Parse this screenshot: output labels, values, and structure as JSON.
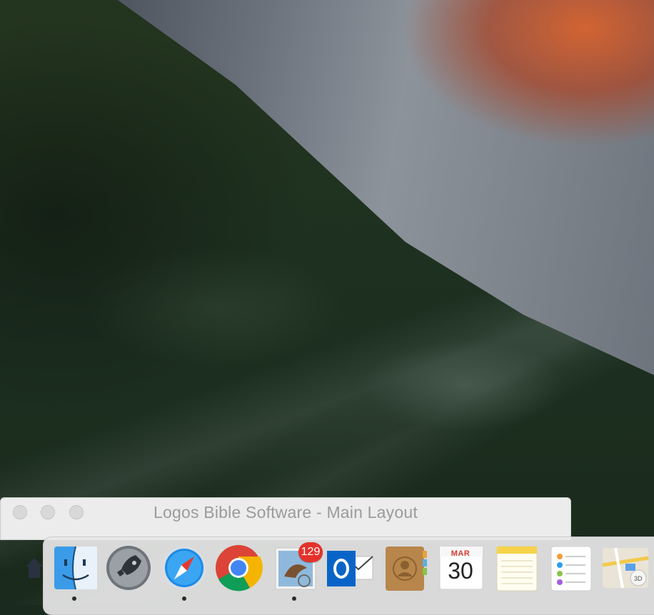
{
  "window": {
    "title": "Logos Bible Software - Main Layout"
  },
  "dock": {
    "items": [
      {
        "name": "Finder",
        "icon": "finder-icon",
        "running": true
      },
      {
        "name": "Launchpad",
        "icon": "rocket-icon",
        "running": false
      },
      {
        "name": "Safari",
        "icon": "compass-icon",
        "running": true
      },
      {
        "name": "Google Chrome",
        "icon": "chrome-icon",
        "running": false
      },
      {
        "name": "Mail",
        "icon": "mail-stamp-icon",
        "running": true,
        "badge": "129"
      },
      {
        "name": "Microsoft Outlook",
        "icon": "outlook-icon",
        "running": false
      },
      {
        "name": "Contacts",
        "icon": "contacts-book-icon",
        "running": false
      },
      {
        "name": "Calendar",
        "icon": "calendar-icon",
        "running": false,
        "month": "MAR",
        "day": "30"
      },
      {
        "name": "Notes",
        "icon": "notepad-icon",
        "running": false
      },
      {
        "name": "Reminders",
        "icon": "checklist-icon",
        "running": false
      },
      {
        "name": "Maps",
        "icon": "map-icon",
        "running": false
      }
    ]
  },
  "colors": {
    "badge": "#e4322b",
    "window_chrome": "#ececec",
    "dock_bg": "#e8e8e8"
  }
}
